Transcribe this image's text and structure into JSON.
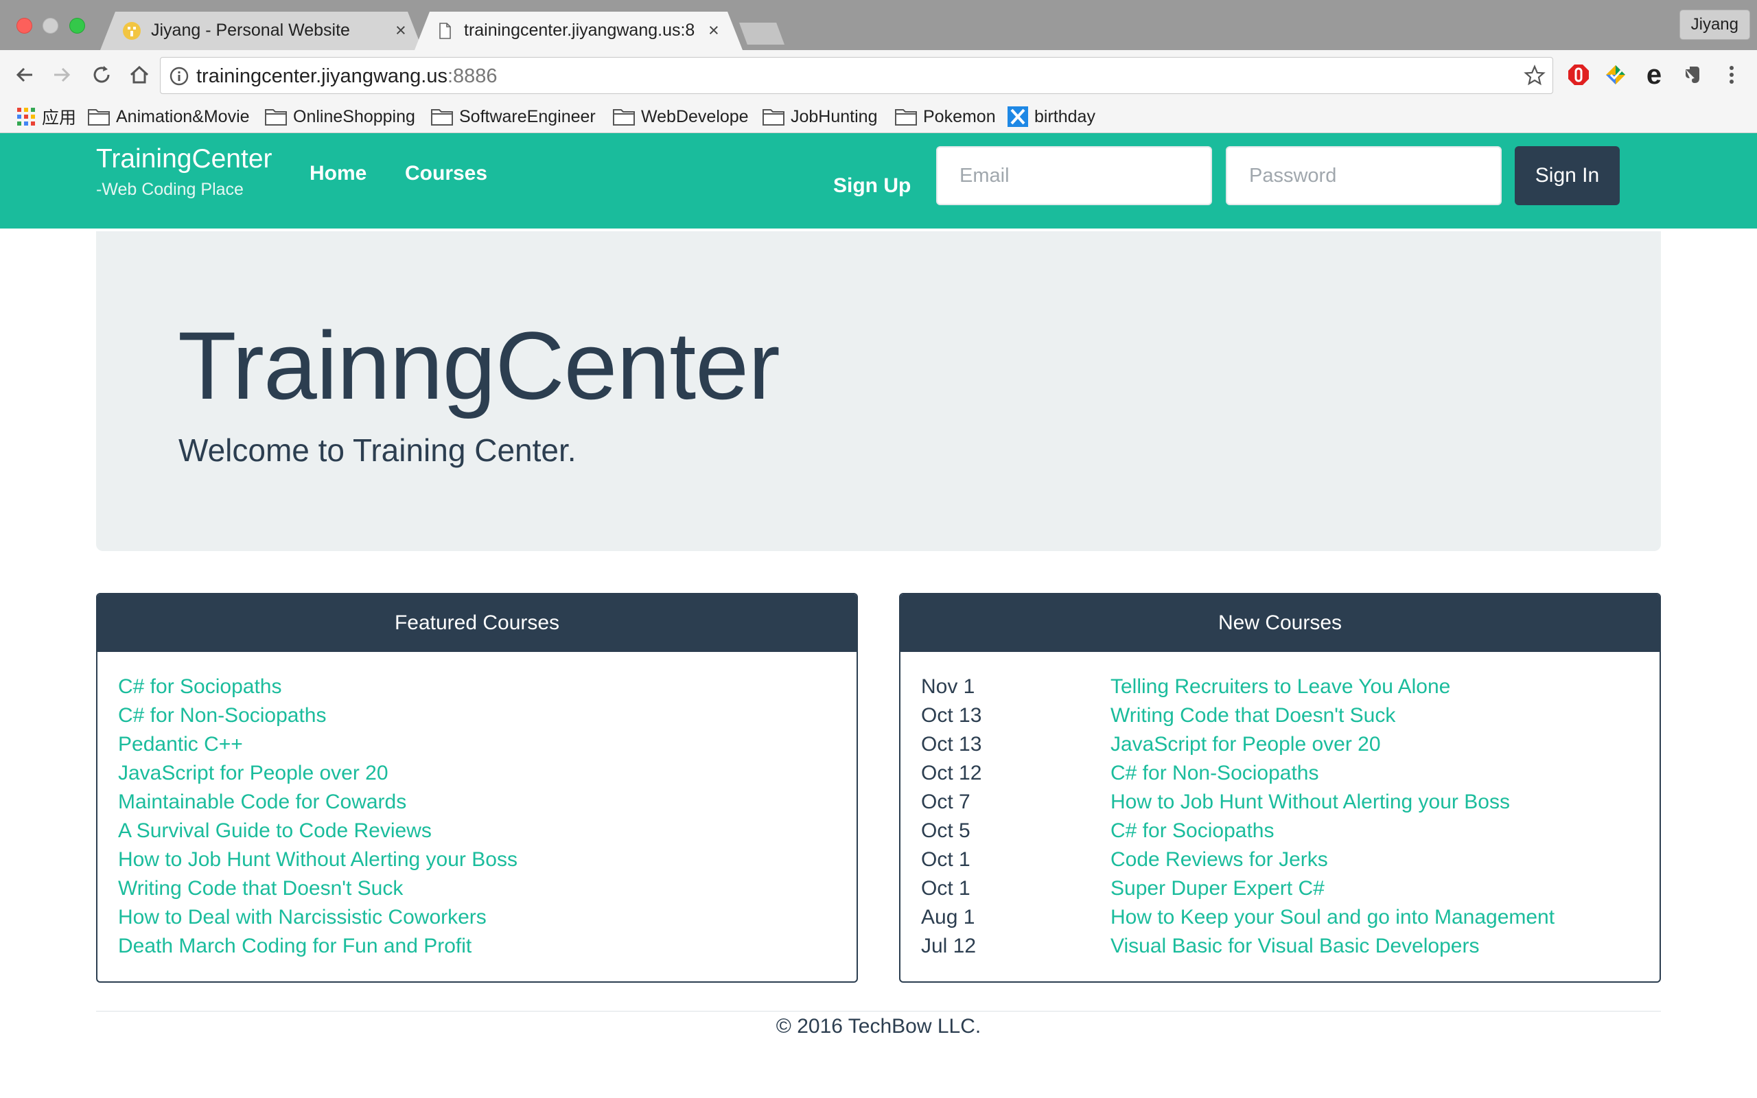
{
  "browser": {
    "tabs": [
      {
        "title": "Jiyang - Personal Website",
        "active": false
      },
      {
        "title": "trainingcenter.jiyangwang.us:8",
        "active": true
      }
    ],
    "profile_name": "Jiyang",
    "url_host": "trainingcenter.jiyangwang.us",
    "url_port": ":8886",
    "bookmarks": [
      "应用",
      "Animation&Movie",
      "OnlineShopping",
      "SoftwareEngineer",
      "WebDevelope",
      "JobHunting",
      "Pokemon",
      "birthday"
    ]
  },
  "navbar": {
    "brand": "TrainingCenter",
    "tagline": "-Web Coding Place",
    "links": [
      "Home",
      "Courses"
    ],
    "signup": "Sign Up",
    "email_placeholder": "Email",
    "password_placeholder": "Password",
    "signin": "Sign In",
    "color": "#1abc9c"
  },
  "jumbotron": {
    "title": "TrainngCenter",
    "subtitle": "Welcome to Training Center."
  },
  "featured": {
    "heading": "Featured Courses",
    "courses": [
      "C# for Sociopaths",
      "C# for Non-Sociopaths",
      "Pedantic C++",
      "JavaScript for People over 20",
      "Maintainable Code for Cowards",
      "A Survival Guide to Code Reviews",
      "How to Job Hunt Without Alerting your Boss",
      "Writing Code that Doesn't Suck",
      "How to Deal with Narcissistic Coworkers",
      "Death March Coding for Fun and Profit"
    ]
  },
  "new_courses": {
    "heading": "New Courses",
    "rows": [
      {
        "date": "Nov 1",
        "title": "Telling Recruiters to Leave You Alone"
      },
      {
        "date": "Oct 13",
        "title": "Writing Code that Doesn't Suck"
      },
      {
        "date": "Oct 13",
        "title": "JavaScript for People over 20"
      },
      {
        "date": "Oct 12",
        "title": "C# for Non-Sociopaths"
      },
      {
        "date": "Oct 7",
        "title": "How to Job Hunt Without Alerting your Boss"
      },
      {
        "date": "Oct 5",
        "title": "C# for Sociopaths"
      },
      {
        "date": "Oct 1",
        "title": "Code Reviews for Jerks"
      },
      {
        "date": "Oct 1",
        "title": "Super Duper Expert C#"
      },
      {
        "date": "Aug 1",
        "title": "How to Keep your Soul and go into Management"
      },
      {
        "date": "Jul 12",
        "title": "Visual Basic for Visual Basic Developers"
      }
    ]
  },
  "footer": "© 2016 TechBow LLC."
}
